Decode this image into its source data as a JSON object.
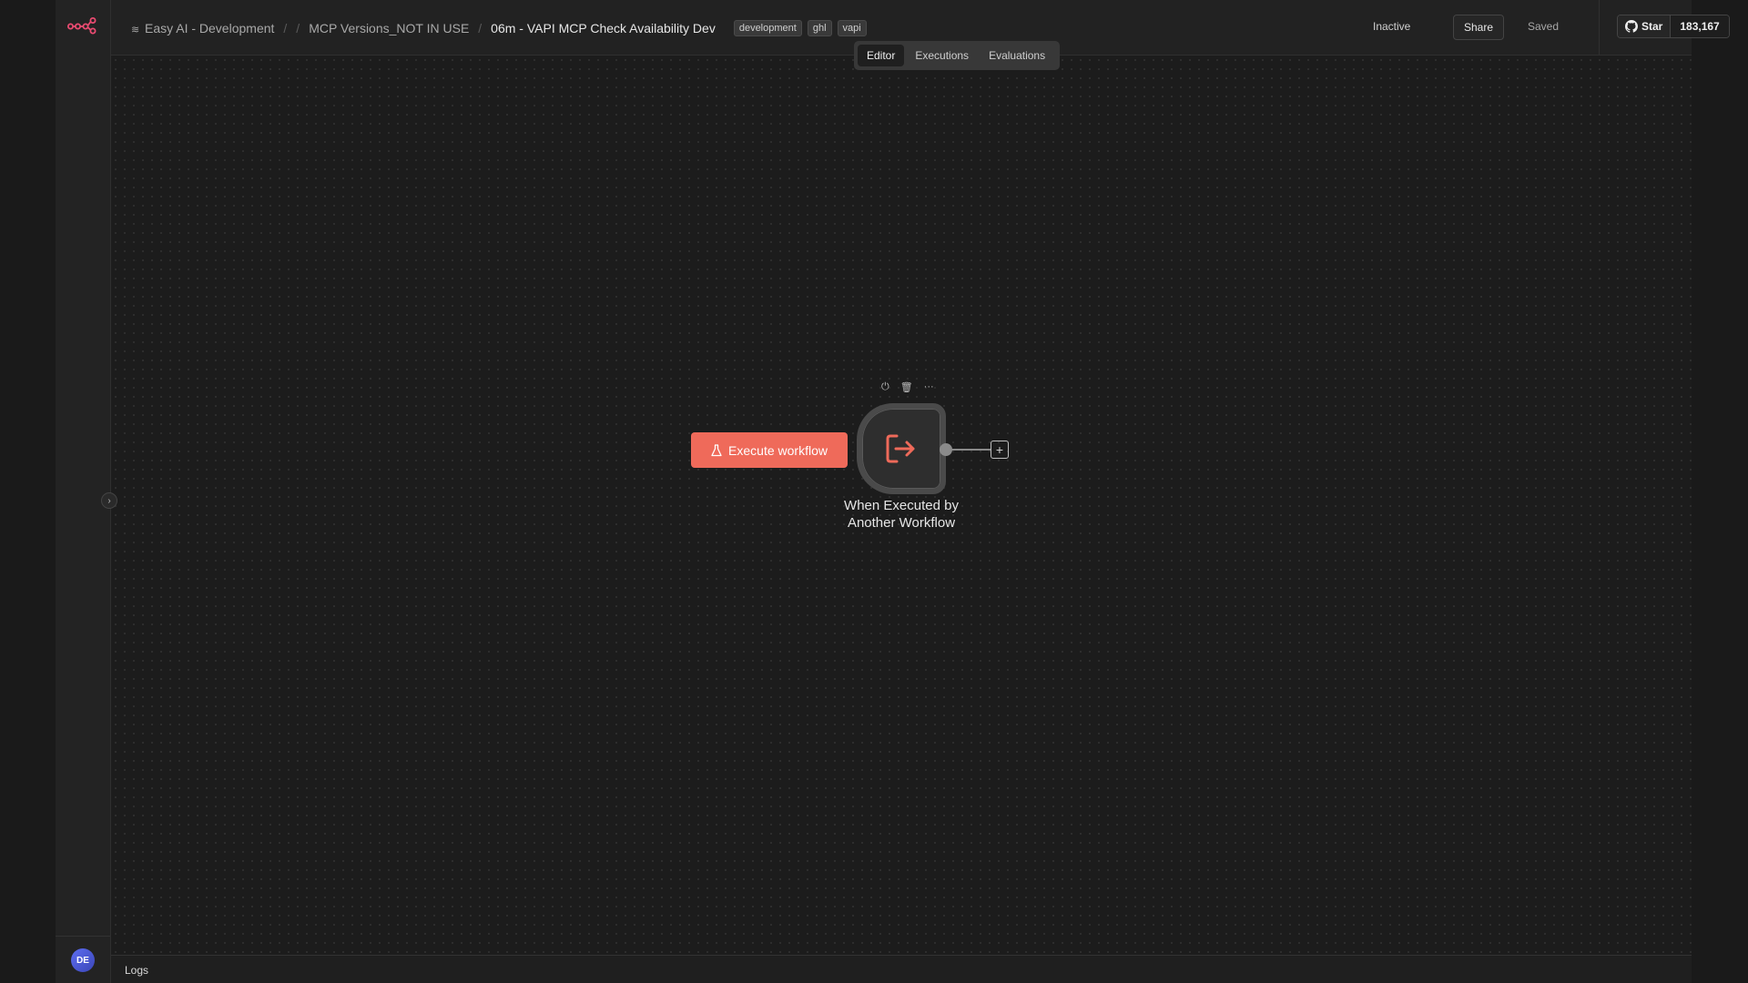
{
  "breadcrumb": {
    "project": "Easy AI - Development",
    "folder": "MCP Versions_NOT IN USE",
    "workflow": "06m - VAPI MCP Check Availability Dev"
  },
  "tags": [
    "development",
    "ghl",
    "vapi"
  ],
  "header": {
    "status": "Inactive",
    "share_label": "Share",
    "saved_label": "Saved",
    "github_star_label": "Star",
    "github_star_count": "183,167"
  },
  "view_tabs": {
    "editor": "Editor",
    "executions": "Executions",
    "evaluations": "Evaluations",
    "active": "Editor"
  },
  "canvas": {
    "execute_button_label": "Execute workflow",
    "node": {
      "label": "When Executed by Another Workflow",
      "icon": "sign-out-icon"
    }
  },
  "sidebar": {
    "avatar_initials": "DE"
  },
  "logs": {
    "label": "Logs"
  },
  "colors": {
    "accent": "#ef6a5a",
    "background": "#1c1c1c"
  }
}
